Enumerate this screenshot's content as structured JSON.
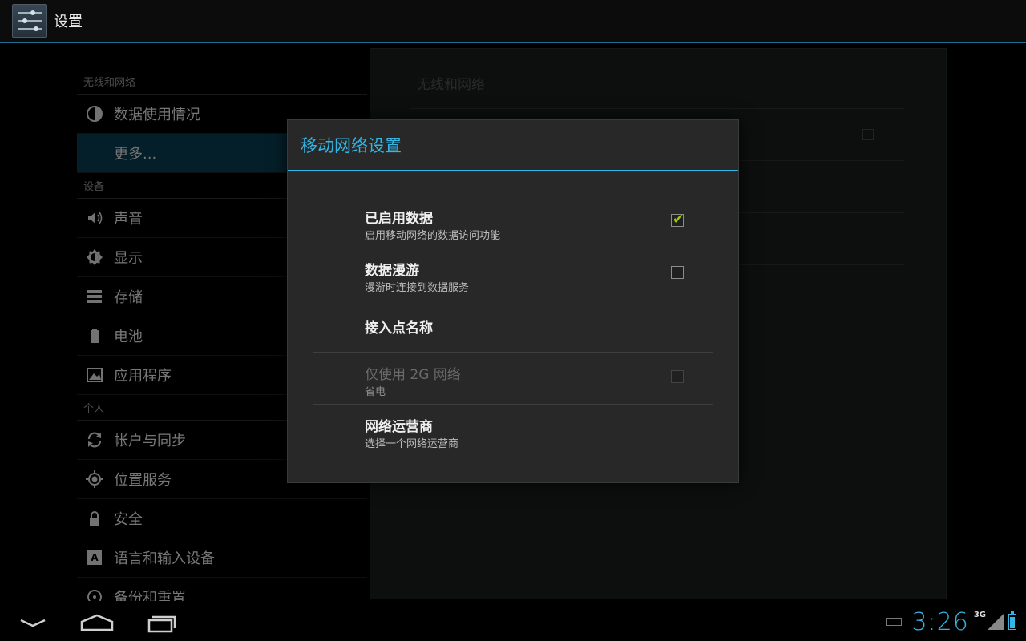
{
  "actionbar": {
    "title": "设置",
    "icon": "settings-sliders-icon"
  },
  "sidebar": {
    "sections": [
      {
        "header": "无线和网络",
        "items": [
          {
            "label": "数据使用情况",
            "icon": "data-usage-icon",
            "selected": false
          },
          {
            "label": "更多...",
            "icon": "",
            "selected": true
          }
        ]
      },
      {
        "header": "设备",
        "items": [
          {
            "label": "声音",
            "icon": "volume-icon",
            "selected": false
          },
          {
            "label": "显示",
            "icon": "brightness-icon",
            "selected": false
          },
          {
            "label": "存储",
            "icon": "storage-icon",
            "selected": false
          },
          {
            "label": "电池",
            "icon": "battery-icon",
            "selected": false
          },
          {
            "label": "应用程序",
            "icon": "apps-icon",
            "selected": false
          }
        ]
      },
      {
        "header": "个人",
        "items": [
          {
            "label": "帐户与同步",
            "icon": "sync-icon",
            "selected": false
          },
          {
            "label": "位置服务",
            "icon": "location-icon",
            "selected": false
          },
          {
            "label": "安全",
            "icon": "lock-icon",
            "selected": false
          },
          {
            "label": "语言和输入设备",
            "icon": "language-icon",
            "selected": false
          },
          {
            "label": "备份和重置",
            "icon": "backup-icon",
            "selected": false
          }
        ]
      }
    ]
  },
  "detail": {
    "header": "无线和网络"
  },
  "dialog": {
    "title": "移动网络设置",
    "prefs": [
      {
        "title": "已启用数据",
        "summary": "启用移动网络的数据访问功能",
        "checkbox": true,
        "checked": true,
        "enabled": true
      },
      {
        "title": "数据漫游",
        "summary": "漫游时连接到数据服务",
        "checkbox": true,
        "checked": false,
        "enabled": true
      },
      {
        "title": "接入点名称",
        "summary": "",
        "checkbox": false,
        "checked": false,
        "enabled": true
      },
      {
        "title": "仅使用 2G 网络",
        "summary": "省电",
        "checkbox": true,
        "checked": false,
        "enabled": false
      },
      {
        "title": "网络运营商",
        "summary": "选择一个网络运营商",
        "checkbox": false,
        "checked": false,
        "enabled": true
      }
    ]
  },
  "statusbar": {
    "time": "3:26",
    "network": "3G"
  },
  "colors": {
    "accent": "#33b5e5",
    "check": "#99cc00"
  }
}
